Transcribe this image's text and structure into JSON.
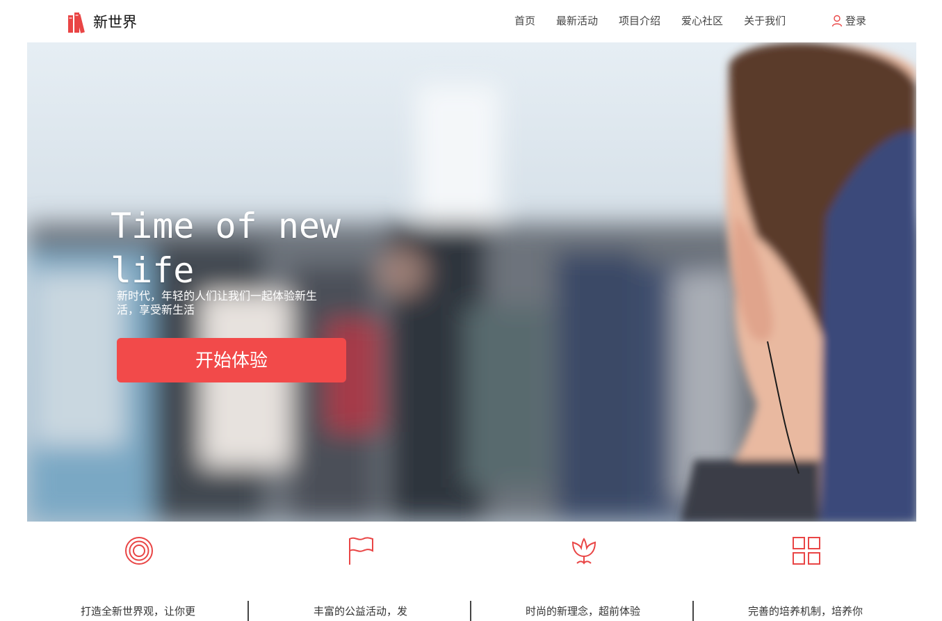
{
  "brand": {
    "name": "新世界",
    "accent_color": "#f24a4a",
    "logo_icon": "books-icon"
  },
  "nav": {
    "items": [
      {
        "label": "首页"
      },
      {
        "label": "最新活动"
      },
      {
        "label": "项目介绍"
      },
      {
        "label": "爱心社区"
      },
      {
        "label": "关于我们"
      }
    ],
    "login_label": "登录",
    "login_icon": "user-icon"
  },
  "hero": {
    "title": "Time of new life",
    "subtitle": "新时代，年轻的人们让我们一起体验新生活，享受新生活",
    "cta_label": "开始体验"
  },
  "features": [
    {
      "icon": "target-icon",
      "text": "打造全新世界观，让你更"
    },
    {
      "icon": "flag-icon",
      "text": "丰富的公益活动，发"
    },
    {
      "icon": "tulip-icon",
      "text": "时尚的新理念，超前体验"
    },
    {
      "icon": "grid-icon",
      "text": "完善的培养机制，培养你"
    }
  ]
}
